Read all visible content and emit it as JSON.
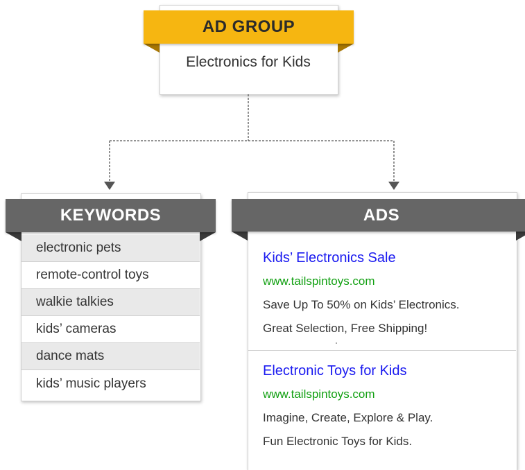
{
  "ad_group": {
    "heading": "AD GROUP",
    "name": "Electronics for Kids",
    "accent_color": "#f6b611"
  },
  "keywords": {
    "heading": "KEYWORDS",
    "items": [
      "electronic pets",
      "remote-control toys",
      "walkie talkies",
      "kids’ cameras",
      "dance mats",
      "kids’ music players"
    ]
  },
  "ads": {
    "heading": "ADS",
    "items": [
      {
        "title": "Kids’ Electronics Sale",
        "url": "www.tailspintoys.com",
        "line1": "Save Up To 50% on Kids’ Electronics.",
        "line2": "Great Selection, Free Shipping!"
      },
      {
        "title": "Electronic Toys for Kids",
        "url": "www.tailspintoys.com",
        "line1": "Imagine, Create, Explore & Play.",
        "line2": "Fun Electronic Toys for Kids."
      }
    ],
    "title_color": "#1a1af0",
    "url_color": "#12a012"
  },
  "banner_color": "#666666"
}
